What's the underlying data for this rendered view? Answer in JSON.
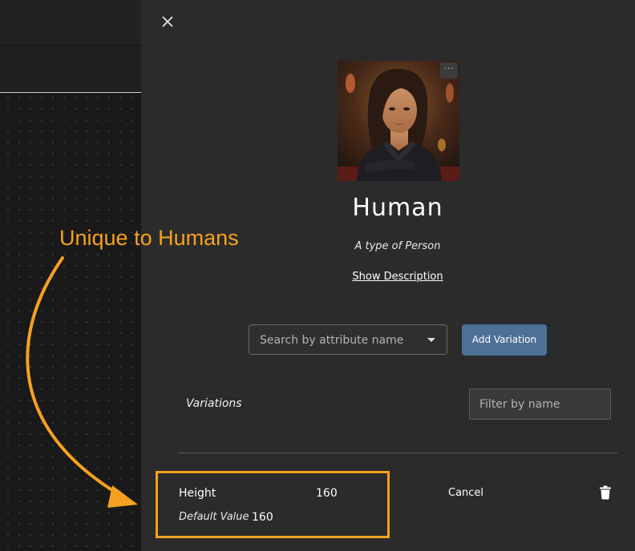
{
  "panel": {
    "entity_title": "Human",
    "entity_subtitle": "A type of Person",
    "show_description": "Show Description",
    "search": {
      "placeholder": "Search by attribute name"
    },
    "add_variation_label": "Add Variation",
    "variations_label": "Variations",
    "filter": {
      "placeholder": "Filter by name"
    },
    "variation_row": {
      "attribute": "Height",
      "value": "160",
      "default_label": "Default Value",
      "default_value": "160",
      "cancel_label": "Cancel"
    },
    "more_label": "···"
  },
  "annotation": {
    "text": "Unique to Humans",
    "color": "#f5a11f"
  },
  "colors": {
    "panel_bg": "#2b2b2b",
    "canvas_bg": "#191919",
    "button_primary": "#4d7196"
  },
  "icons": {
    "close": "close-icon",
    "more": "more-horizontal-icon",
    "caret": "chevron-down-icon",
    "delete": "trash-icon"
  }
}
